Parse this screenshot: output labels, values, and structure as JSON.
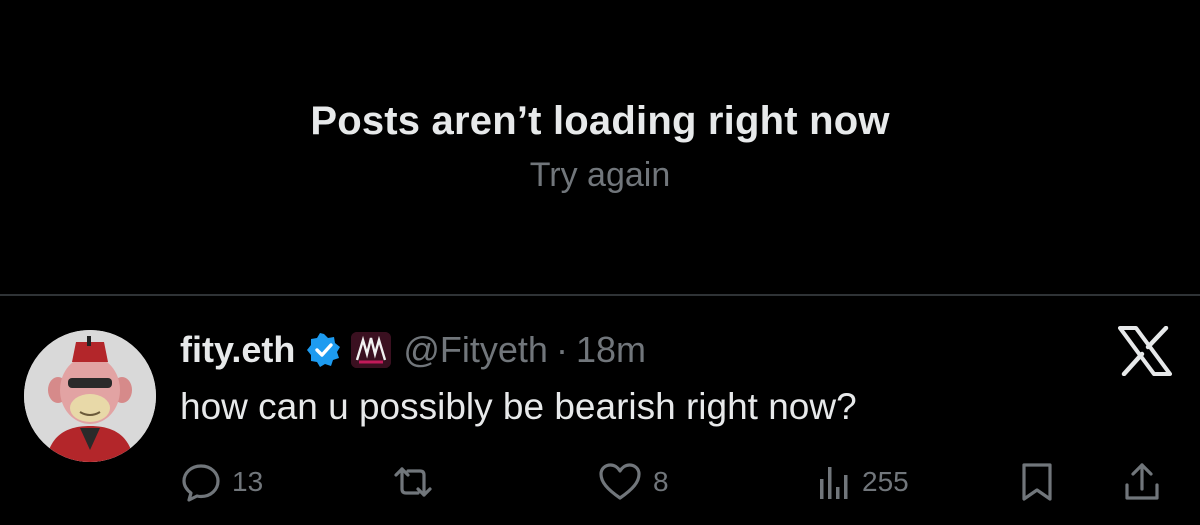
{
  "error": {
    "title": "Posts aren’t loading right now",
    "retry_label": "Try again"
  },
  "post": {
    "display_name": "fity.eth",
    "handle": "@Fityeth",
    "separator": "·",
    "time": "18m",
    "text": "how can u possibly be bearish right now?",
    "verified": true,
    "actions": {
      "replies": "13",
      "reposts": "",
      "likes": "8",
      "views": "255"
    }
  },
  "icons": {
    "verified": "verified-badge-icon",
    "affiliate": "affiliate-badge-icon",
    "brand": "x-logo-icon",
    "reply": "reply-icon",
    "repost": "repost-icon",
    "like": "heart-icon",
    "views": "views-icon",
    "bookmark": "bookmark-icon",
    "share": "share-icon"
  },
  "colors": {
    "background": "#000000",
    "primary_text": "#e7e9ea",
    "secondary_text": "#71767b",
    "divider": "#2f3336",
    "verified_blue": "#1d9bf0"
  }
}
